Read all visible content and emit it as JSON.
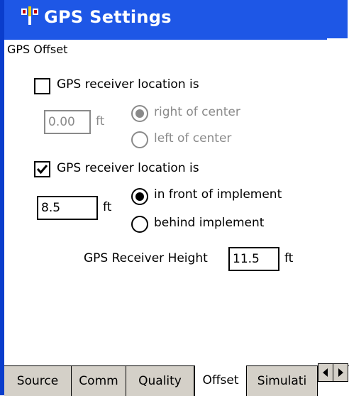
{
  "window": {
    "title": "GPS Settings",
    "icon": "satellite-icon",
    "accent_color": "#1e57e6"
  },
  "section": {
    "label": "GPS Offset"
  },
  "lateral": {
    "checkbox_label": "GPS receiver location is",
    "checked": false,
    "value": "0.00",
    "unit": "ft",
    "options": [
      "right of center",
      "left of center"
    ],
    "selected": "right of center",
    "enabled": false
  },
  "longitudinal": {
    "checkbox_label": "GPS receiver location is",
    "checked": true,
    "value": "8.5",
    "unit": "ft",
    "options": [
      "in front of implement",
      "behind implement"
    ],
    "selected": "in front of implement",
    "enabled": true
  },
  "height": {
    "label": "GPS Receiver Height",
    "value": "11.5",
    "unit": "ft"
  },
  "tabs": [
    {
      "label": "Source"
    },
    {
      "label": "Comm"
    },
    {
      "label": "Quality"
    },
    {
      "label": "Offset",
      "active": true
    },
    {
      "label": "Simulati"
    }
  ],
  "tab_scroll": {
    "left_icon": "arrow-left-icon",
    "right_icon": "arrow-right-icon"
  }
}
